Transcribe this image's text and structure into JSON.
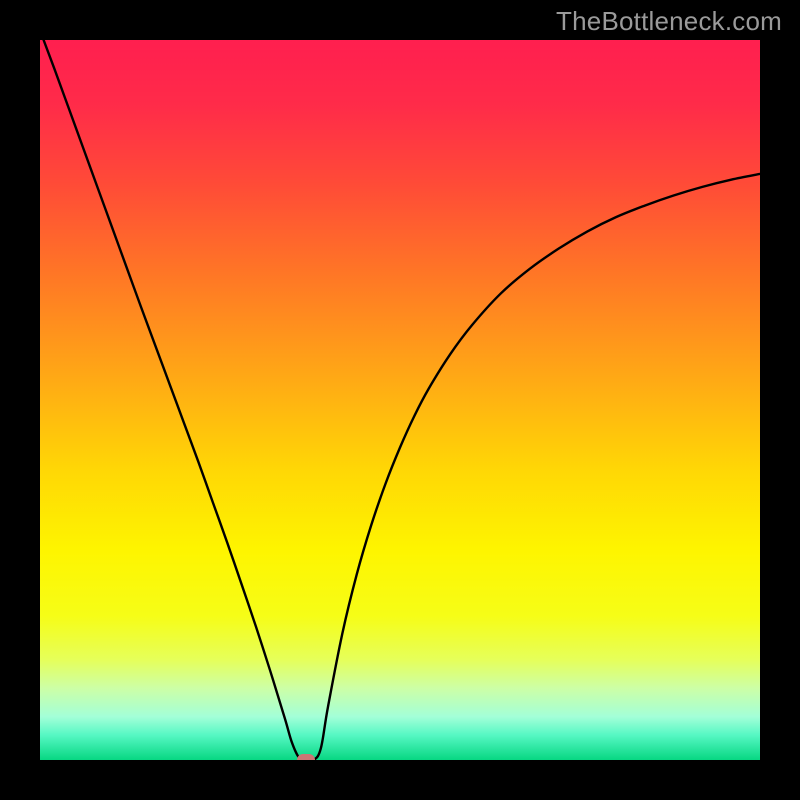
{
  "watermark": "TheBottleneck.com",
  "chart_data": {
    "type": "line",
    "title": "",
    "xlabel": "",
    "ylabel": "",
    "xlim": [
      0,
      100
    ],
    "ylim": [
      0,
      100
    ],
    "background_gradient": {
      "stops": [
        {
          "offset": 0.0,
          "color": "#ff1f4f"
        },
        {
          "offset": 0.09,
          "color": "#ff2b49"
        },
        {
          "offset": 0.2,
          "color": "#ff4b37"
        },
        {
          "offset": 0.33,
          "color": "#ff7825"
        },
        {
          "offset": 0.47,
          "color": "#ffa915"
        },
        {
          "offset": 0.6,
          "color": "#ffd805"
        },
        {
          "offset": 0.71,
          "color": "#fef500"
        },
        {
          "offset": 0.8,
          "color": "#f6fd17"
        },
        {
          "offset": 0.86,
          "color": "#e6ff59"
        },
        {
          "offset": 0.9,
          "color": "#cdffa6"
        },
        {
          "offset": 0.94,
          "color": "#a3ffd8"
        },
        {
          "offset": 0.965,
          "color": "#57f8c4"
        },
        {
          "offset": 1.0,
          "color": "#07d782"
        }
      ]
    },
    "series": [
      {
        "name": "bottleneck-curve",
        "color": "#000000",
        "stroke_width": 2.4,
        "x": [
          0.5,
          2,
          4,
          6,
          8,
          10,
          12,
          14,
          16,
          18,
          20,
          22,
          24,
          26,
          28,
          30,
          32,
          34,
          35,
          36,
          37,
          38,
          39,
          40,
          42,
          44,
          46,
          48,
          50,
          52,
          54,
          57,
          60,
          64,
          68,
          72,
          76,
          80,
          84,
          88,
          92,
          96,
          100
        ],
        "y": [
          100,
          96,
          90.5,
          85,
          79.5,
          74,
          68.5,
          63,
          57.6,
          52.2,
          46.8,
          41.4,
          35.8,
          30.2,
          24.4,
          18.5,
          12.3,
          5.8,
          2.4,
          0.3,
          0.0,
          0.0,
          1.6,
          7.4,
          17.6,
          25.8,
          32.6,
          38.4,
          43.4,
          47.8,
          51.6,
          56.4,
          60.4,
          64.8,
          68.2,
          71.0,
          73.4,
          75.4,
          77.0,
          78.4,
          79.6,
          80.6,
          81.4
        ]
      }
    ],
    "marker": {
      "name": "min-point-marker",
      "x": 37.0,
      "y": 0.0,
      "color": "#cb7775"
    }
  }
}
